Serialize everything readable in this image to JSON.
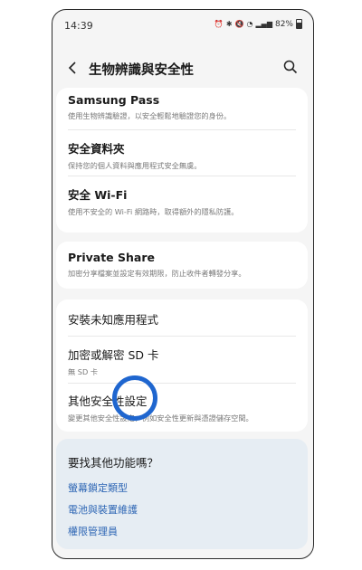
{
  "status": {
    "time": "14:39",
    "battery": "82%",
    "icons": [
      "alarm-icon",
      "bluetooth-icon",
      "mute-icon",
      "wifi-icon",
      "signal-icon"
    ]
  },
  "header": {
    "title": "生物辨識與安全性",
    "back_icon": "back-arrow-icon",
    "search_icon": "search-icon"
  },
  "sections": {
    "group1": [
      {
        "title": "Samsung Pass",
        "subtitle": "使用生物辨識驗證，以安全輕鬆地驗證您的身份。"
      },
      {
        "title": "安全資料夾",
        "subtitle": "保持您的個人資料與應用程式安全無虞。"
      },
      {
        "title": "安全 Wi-Fi",
        "subtitle": "使用不安全的 Wi-Fi 網路時，取得額外的隱私防護。"
      }
    ],
    "group2": [
      {
        "title": "Private Share",
        "subtitle": "加密分享檔案並設定有效期限，防止收件者轉發分享。"
      }
    ],
    "group3": [
      {
        "title": "安裝未知應用程式",
        "subtitle": ""
      },
      {
        "title": "加密或解密 SD 卡",
        "subtitle": "無 SD 卡"
      },
      {
        "title": "其他安全性設定",
        "subtitle": "變更其他安全性設定，例如安全性更新與憑證儲存空間。"
      }
    ]
  },
  "help": {
    "title": "要找其他功能嗎？",
    "links": [
      "螢幕鎖定類型",
      "電池與裝置維護",
      "權限管理員"
    ]
  },
  "colors": {
    "link": "#2f67b5",
    "highlight_circle": "#1f66cf",
    "background": "#f5f5f5"
  }
}
